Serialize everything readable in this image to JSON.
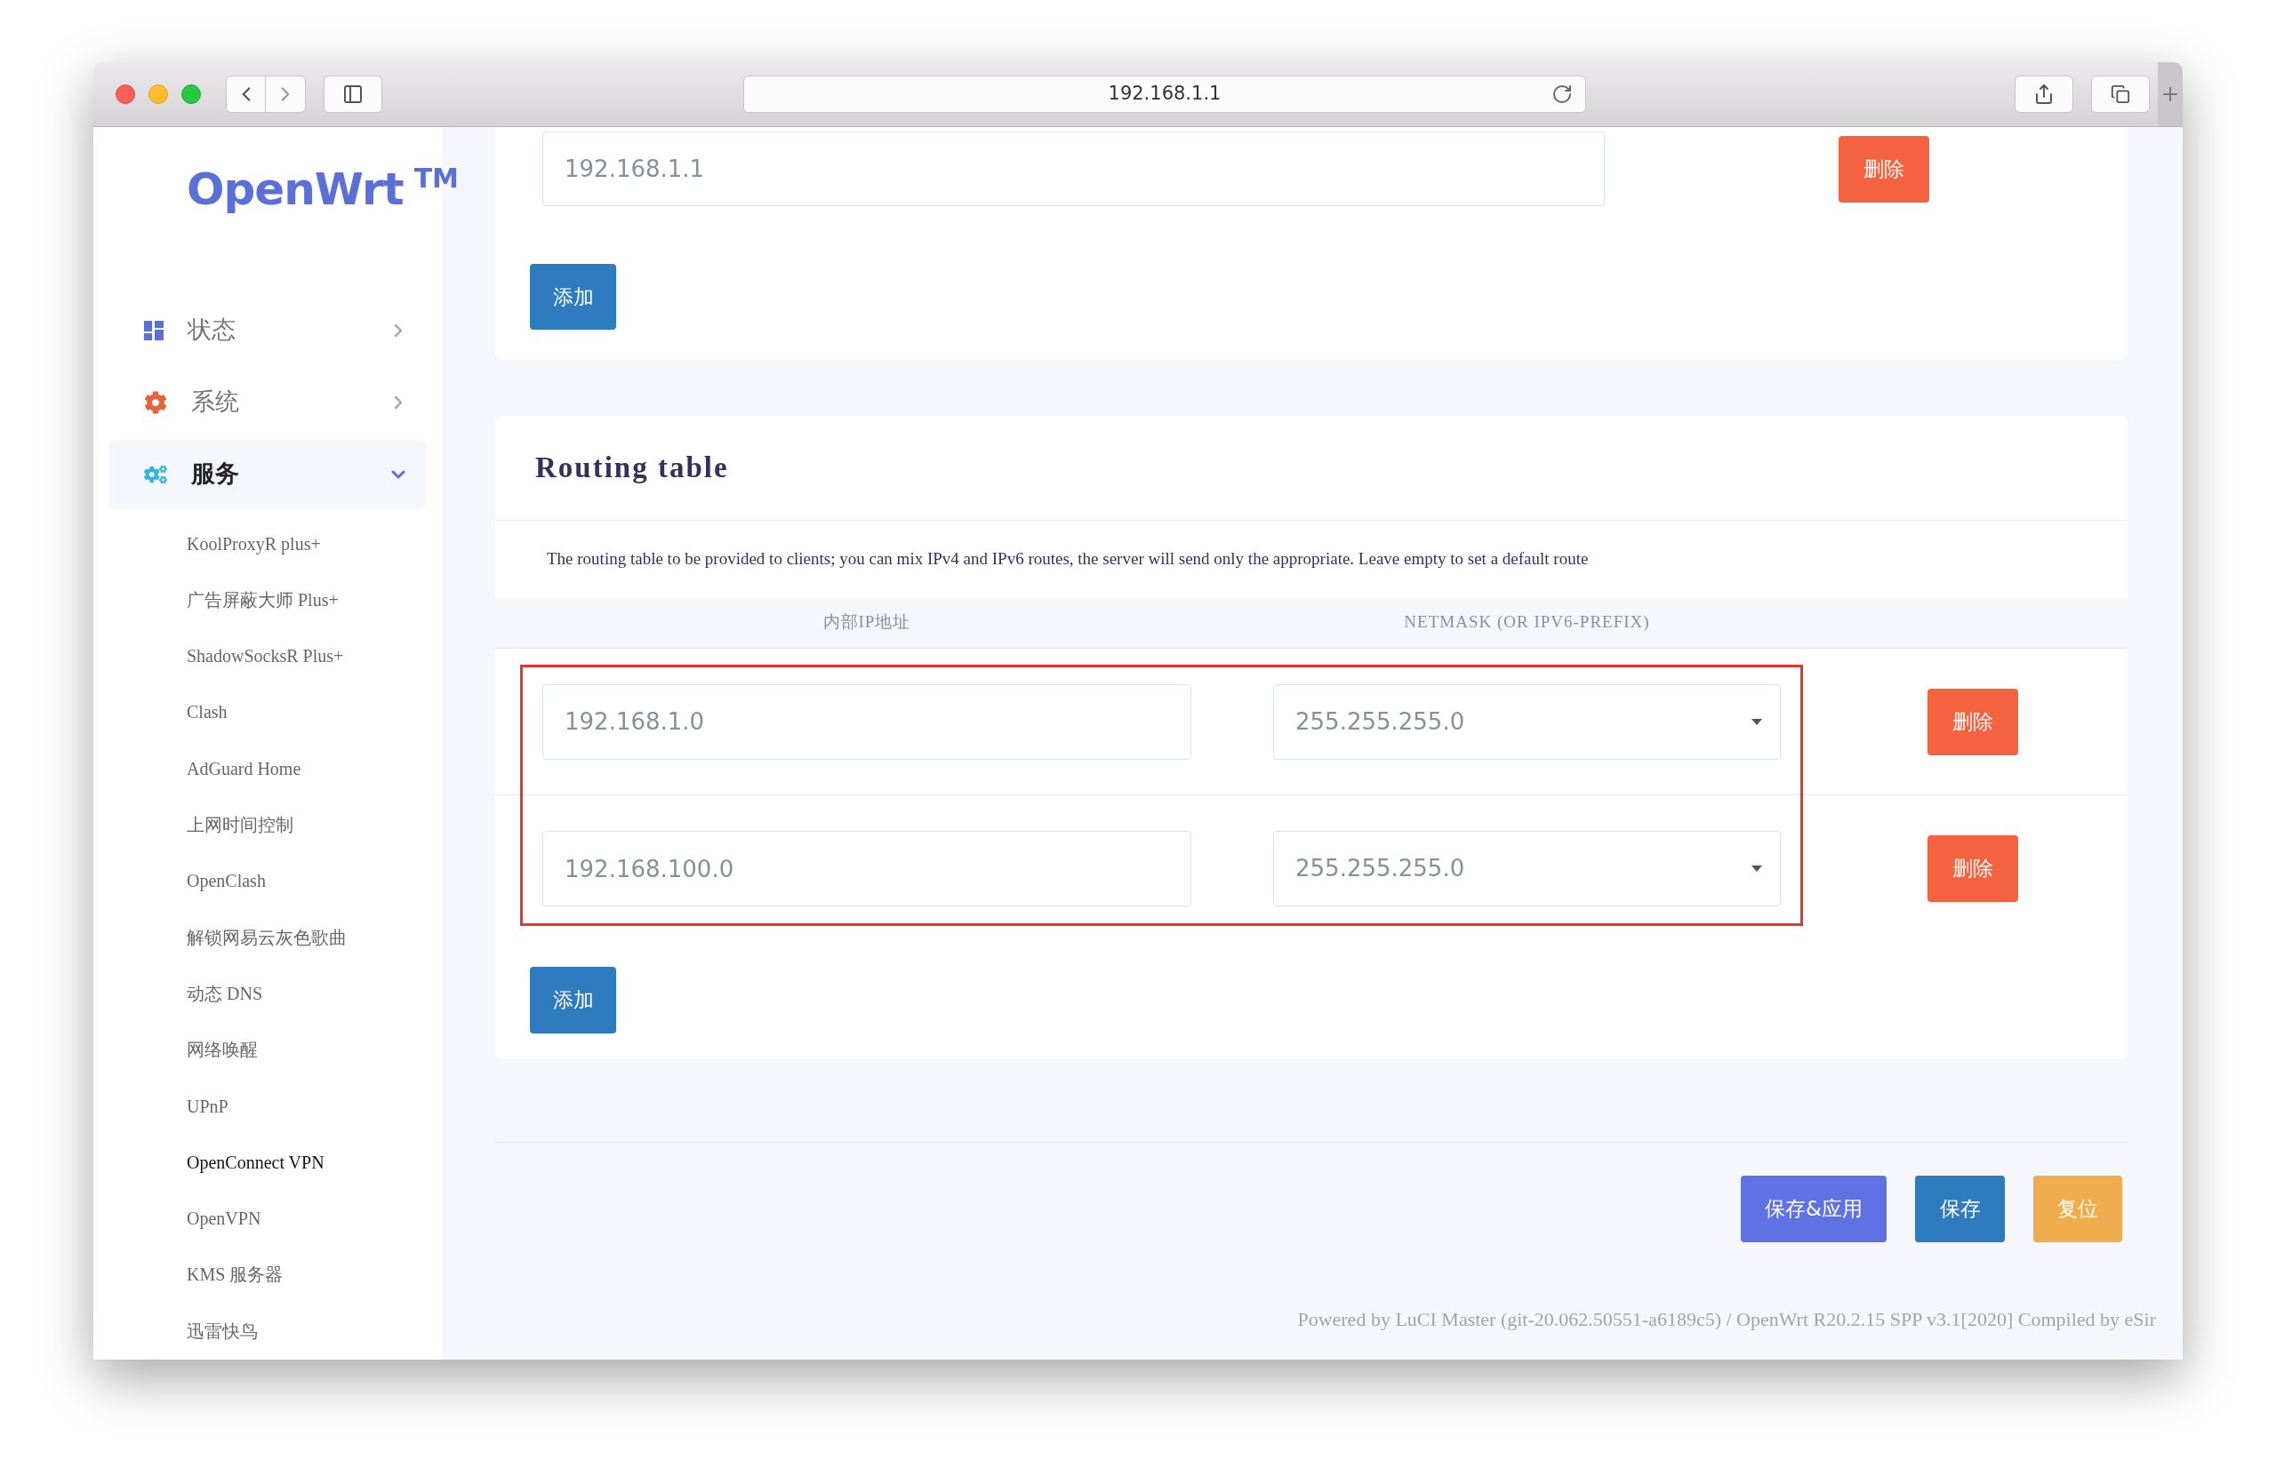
{
  "browser": {
    "url": "192.168.1.1"
  },
  "sidebar": {
    "logo": "OpenWrt",
    "logo_mark": "TM",
    "menu": [
      {
        "label": "状态",
        "kind": "status",
        "expanded": false
      },
      {
        "label": "系统",
        "kind": "system",
        "expanded": false
      },
      {
        "label": "服务",
        "kind": "services",
        "expanded": true,
        "children": [
          {
            "label": "KoolProxyR plus+",
            "selected": false
          },
          {
            "label": "广告屏蔽大师 Plus+",
            "selected": false
          },
          {
            "label": "ShadowSocksR Plus+",
            "selected": false
          },
          {
            "label": "Clash",
            "selected": false
          },
          {
            "label": "AdGuard Home",
            "selected": false
          },
          {
            "label": "上网时间控制",
            "selected": false
          },
          {
            "label": "OpenClash",
            "selected": false
          },
          {
            "label": "解锁网易云灰色歌曲",
            "selected": false
          },
          {
            "label": "动态 DNS",
            "selected": false
          },
          {
            "label": "网络唤醒",
            "selected": false
          },
          {
            "label": "UPnP",
            "selected": false
          },
          {
            "label": "OpenConnect VPN",
            "selected": true
          },
          {
            "label": "OpenVPN",
            "selected": false
          },
          {
            "label": "KMS 服务器",
            "selected": false
          },
          {
            "label": "迅雷快鸟",
            "selected": false
          }
        ]
      }
    ]
  },
  "top_section": {
    "entries": [
      {
        "value": "192.168.1.1",
        "delete_label": "删除"
      }
    ],
    "add_label": "添加"
  },
  "routing_table": {
    "title": "Routing table",
    "description": "The routing table to be provided to clients; you can mix IPv4 and IPv6 routes, the server will send only the appropriate. Leave empty to set a default route",
    "columns": [
      "内部IP地址",
      "NETMASK (OR IPV6-PREFIX)"
    ],
    "highlighted": true,
    "rows": [
      {
        "address": "192.168.1.0",
        "netmask": "255.255.255.0",
        "delete_label": "删除"
      },
      {
        "address": "192.168.100.0",
        "netmask": "255.255.255.0",
        "delete_label": "删除"
      }
    ],
    "add_label": "添加"
  },
  "actions": [
    {
      "label": "保存&应用",
      "kind": "apply"
    },
    {
      "label": "保存",
      "kind": "save"
    },
    {
      "label": "复位",
      "kind": "reset"
    }
  ],
  "footer": "Powered by LuCI Master (git-20.062.50551-a6189c5) / OpenWrt R20.2.15 SPP v3.1[2020] Compiled by eSir"
}
